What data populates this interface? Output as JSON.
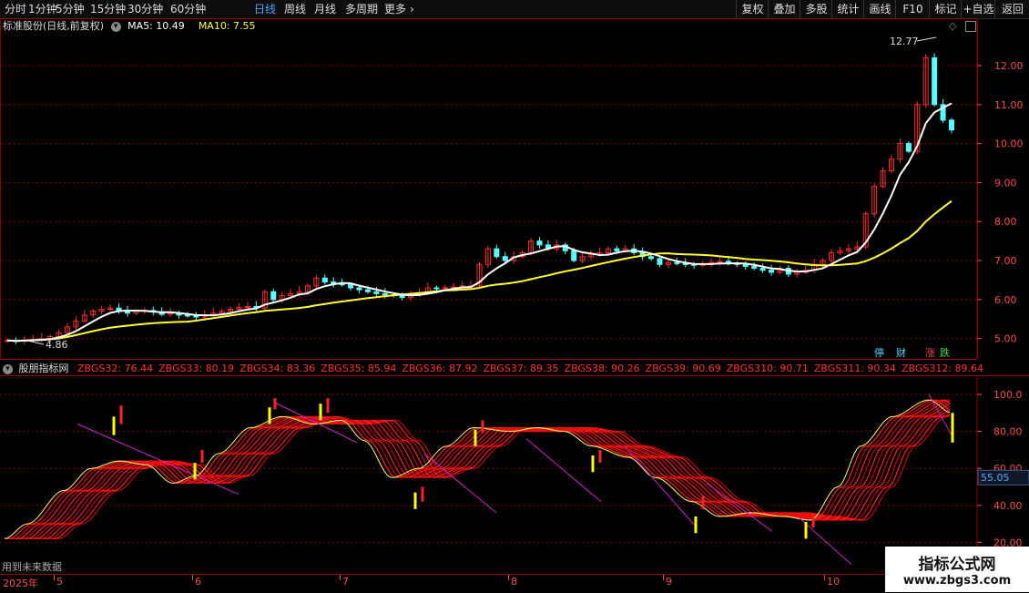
{
  "toolbar": {
    "tabs": [
      {
        "label": "分时",
        "active": false
      },
      {
        "label": "1分钟",
        "active": false
      },
      {
        "label": "5分钟",
        "active": false
      },
      {
        "label": "15分钟",
        "active": false
      },
      {
        "label": "30分钟",
        "active": false
      },
      {
        "label": "60分钟",
        "active": false
      },
      {
        "label": "日线",
        "active": true
      },
      {
        "label": "周线",
        "active": false
      },
      {
        "label": "月线",
        "active": false
      },
      {
        "label": "多周期",
        "active": false
      },
      {
        "label": "更多",
        "active": false
      }
    ],
    "right_buttons": [
      "复权",
      "叠加",
      "多股",
      "统计",
      "画线",
      "F10",
      "标记",
      "+自选",
      "返回"
    ]
  },
  "main_header": {
    "title": "标准股份(日线,前复权)",
    "ma5_label": "MA5: 10.49",
    "ma10_label": "MA10: 7.55"
  },
  "main_chart": {
    "y_ticks": [
      "12.00",
      "11.00",
      "10.00",
      "9.00",
      "8.00",
      "7.00",
      "6.00",
      "5.00"
    ],
    "y_tick_values": [
      12,
      11,
      10,
      9,
      8,
      7,
      6,
      5
    ],
    "high_label": "12.77",
    "low_label": "4.86",
    "badges": [
      {
        "text": "停",
        "color": "#4ad7ff"
      },
      {
        "text": "财",
        "color": "#4ad7ff"
      },
      {
        "text": "涨",
        "color": "#ff4040"
      },
      {
        "text": "跌",
        "color": "#38d838"
      }
    ]
  },
  "sub_header": {
    "title": "股朋指标网",
    "items": [
      "ZBGS32: 76.44",
      "ZBGS33: 80.19",
      "ZBGS34: 83.36",
      "ZBGS35: 85.94",
      "ZBGS36: 87.92",
      "ZBGS37: 89.35",
      "ZBGS38: 90.26",
      "ZBGS39: 90.69",
      "ZBGS310: 90.71",
      "ZBGS311: 90.34",
      "ZBGS312: 89.64"
    ]
  },
  "sub_chart": {
    "y_ticks": [
      "100.0",
      "80.00",
      "60.00",
      "40.00",
      "20.00"
    ],
    "y_tick_values": [
      100,
      80,
      60,
      40,
      20
    ],
    "current_value": "55.05",
    "footer_note": "用到未来数据"
  },
  "time_axis": {
    "labels": [
      "2025年",
      "5",
      "6",
      "7",
      "8",
      "9",
      "10"
    ]
  },
  "watermark": {
    "title": "指标公式网",
    "url": "www.zbgs3.com"
  },
  "colors": {
    "up": "#ff2a2a",
    "down": "#54ffff",
    "ma5": "#ffffff",
    "ma10": "#ffff33",
    "grid": "#8b0000",
    "accent": "#4aa8ff"
  },
  "chart_data": {
    "type": "candlestick",
    "ma5": "10.49",
    "ma10": "7.55",
    "high": 12.77,
    "low": 4.86,
    "close_series": [
      4.95,
      4.93,
      4.96,
      4.98,
      5.0,
      5.05,
      5.15,
      5.3,
      5.45,
      5.6,
      5.7,
      5.75,
      5.78,
      5.7,
      5.65,
      5.7,
      5.72,
      5.68,
      5.62,
      5.65,
      5.6,
      5.58,
      5.55,
      5.6,
      5.65,
      5.7,
      5.75,
      5.8,
      5.82,
      5.78,
      6.2,
      6.0,
      6.1,
      6.15,
      6.2,
      6.35,
      6.55,
      6.45,
      6.4,
      6.38,
      6.3,
      6.25,
      6.2,
      6.15,
      6.12,
      6.1,
      6.05,
      6.12,
      6.18,
      6.3,
      6.28,
      6.3,
      6.32,
      6.35,
      6.35,
      6.9,
      7.3,
      7.1,
      7.0,
      7.1,
      7.2,
      7.5,
      7.4,
      7.3,
      7.4,
      7.25,
      7.0,
      7.1,
      7.15,
      7.2,
      7.3,
      7.25,
      7.3,
      7.2,
      7.1,
      7.05,
      6.9,
      6.95,
      6.92,
      6.9,
      6.88,
      6.9,
      6.95,
      6.98,
      6.92,
      6.9,
      6.85,
      6.8,
      6.75,
      6.7,
      6.8,
      6.65,
      6.7,
      6.75,
      6.9,
      7.0,
      7.2,
      7.25,
      7.3,
      7.35,
      8.2,
      8.9,
      9.3,
      9.6,
      10.0,
      9.8,
      11.0,
      12.2,
      11.0,
      10.6,
      10.35
    ],
    "zbgs_values": {
      "ZBGS32": 76.44,
      "ZBGS33": 80.19,
      "ZBGS34": 83.36,
      "ZBGS35": 85.94,
      "ZBGS36": 87.92,
      "ZBGS37": 89.35,
      "ZBGS38": 90.26,
      "ZBGS39": 90.69,
      "ZBGS310": 90.71,
      "ZBGS311": 90.34,
      "ZBGS312": 89.64
    }
  }
}
